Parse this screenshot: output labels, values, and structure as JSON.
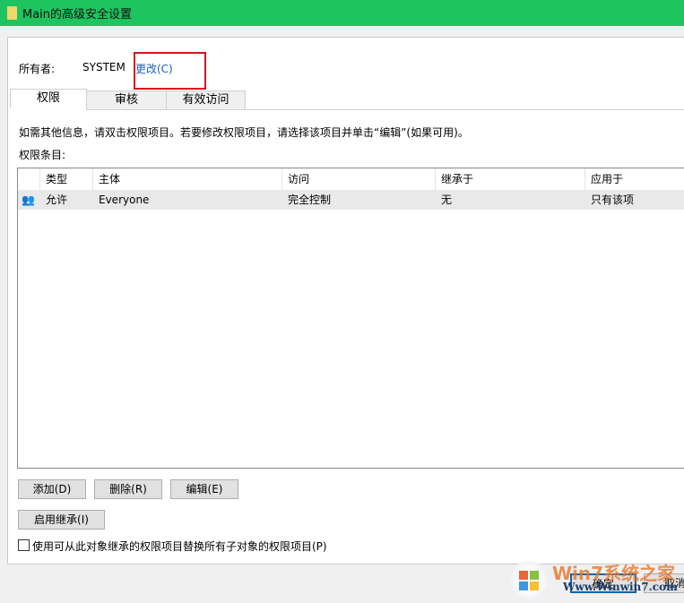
{
  "window": {
    "title": "Main的高级安全设置"
  },
  "owner": {
    "label": "所有者:",
    "value": "SYSTEM",
    "change_link": "更改(C)"
  },
  "tabs": [
    {
      "label": "权限"
    },
    {
      "label": "审核"
    },
    {
      "label": "有效访问"
    }
  ],
  "info_text": "如需其他信息，请双击权限项目。若要修改权限项目，请选择该项目并单击“编辑”(如果可用)。",
  "entries_label": "权限条目:",
  "table": {
    "columns": [
      "类型",
      "主体",
      "访问",
      "继承于",
      "应用于"
    ],
    "rows": [
      {
        "icon": "users-icon",
        "type": "允许",
        "principal": "Everyone",
        "access": "完全控制",
        "inherited_from": "无",
        "applies_to": "只有该项"
      }
    ]
  },
  "buttons": {
    "add": "添加(D)",
    "remove": "删除(R)",
    "edit": "编辑(E)",
    "enable_inheritance": "启用继承(I)",
    "ok": "确定",
    "cancel": "取消"
  },
  "replace_checkbox": {
    "label": "使用可从此对象继承的权限项目替换所有子对象的权限项目(P)",
    "checked": false
  },
  "watermark": {
    "text": "Win7系统之家",
    "url": "Www.Winwin7.com"
  },
  "colors": {
    "titlebar": "#1ec45f",
    "highlight_box": "#d7141a",
    "link": "#1a5fb4"
  }
}
